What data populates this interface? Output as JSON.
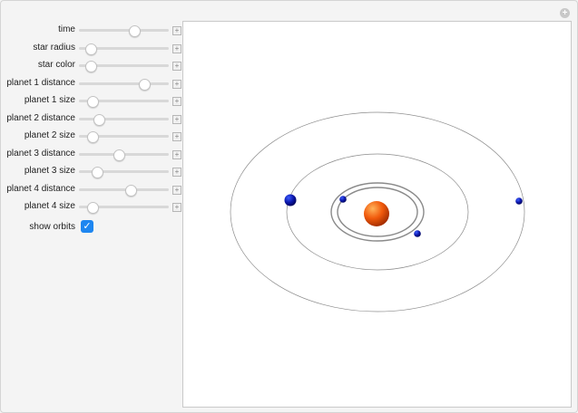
{
  "controls": {
    "sliders": [
      {
        "label": "time",
        "value": 0.62
      },
      {
        "label": "star radius",
        "value": 0.13
      },
      {
        "label": "star color",
        "value": 0.13
      },
      {
        "label": "planet 1 distance",
        "value": 0.73
      },
      {
        "label": "planet 1 size",
        "value": 0.15
      },
      {
        "label": "planet 2 distance",
        "value": 0.22
      },
      {
        "label": "planet 2 size",
        "value": 0.15
      },
      {
        "label": "planet 3 distance",
        "value": 0.44
      },
      {
        "label": "planet 3 size",
        "value": 0.2
      },
      {
        "label": "planet 4 distance",
        "value": 0.58
      },
      {
        "label": "planet 4 size",
        "value": 0.15
      }
    ],
    "show_orbits": {
      "label": "show orbits",
      "checked": true
    }
  },
  "colors": {
    "star": "#f15a0c",
    "planet": "#0a16a8",
    "orbit": "#8a8a8a",
    "checkbox": "#1e86f0"
  },
  "icons": {
    "reset": "reset-icon",
    "increment": "plus-icon",
    "check": "check-icon"
  }
}
